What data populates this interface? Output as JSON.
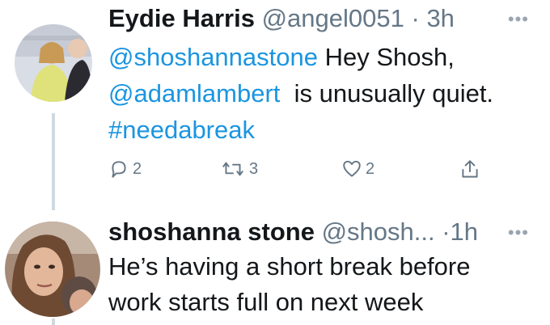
{
  "tweets": [
    {
      "name": "Eydie Harris",
      "handle": "@angel0051",
      "separator": "·",
      "time": "3h",
      "more": "•••",
      "text": {
        "mention1": "@shoshannastone",
        "t1": " Hey Shosh,",
        "mention2": "@adamlambert",
        "t2": "  is unusually quiet.",
        "hashtag": "#needabreak"
      },
      "actions": {
        "reply_count": "2",
        "retweet_count": "3",
        "like_count": "2"
      }
    },
    {
      "name": "shoshanna stone",
      "handle": "@shosh...",
      "separator": "·",
      "time": "1h",
      "more": "•••",
      "text": {
        "line1": "He’s having a short break before",
        "line2": "work starts full on next week"
      }
    }
  ],
  "colors": {
    "link": "#1b95e0",
    "secondary_text": "#657786",
    "thread_line": "#cfd9de"
  },
  "icons": [
    "reply-icon",
    "retweet-icon",
    "like-icon",
    "share-icon",
    "more-icon"
  ]
}
